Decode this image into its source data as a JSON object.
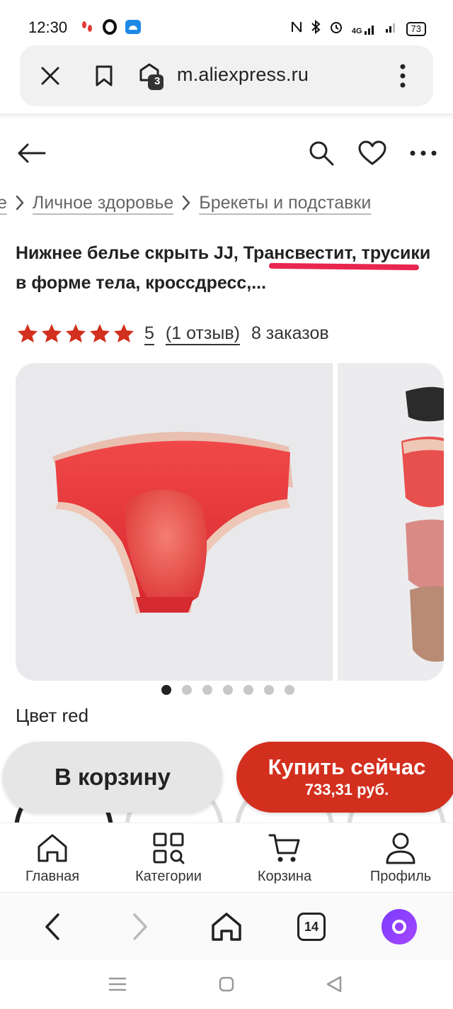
{
  "status": {
    "time": "12:30",
    "network": "4G",
    "battery": "73"
  },
  "browser": {
    "url": "m.aliexpress.ru",
    "tabs_badge": "3"
  },
  "breadcrumb": {
    "partial": "е",
    "items": [
      "Личное здоровье",
      "Брекеты и подставки"
    ]
  },
  "product": {
    "title": "Нижнее белье скрыть JJ, Трансвестит, трусики в форме тела, кроссдресс,...",
    "rating": "5",
    "reviews": "(1 отзыв)",
    "orders": "8 заказов",
    "color_label": "Цвет red",
    "accent_color": "#d32f1e",
    "highlight_color": "#e8264f",
    "gallery_slides": 7,
    "active_slide": 1
  },
  "actions": {
    "cart_label": "В корзину",
    "buy_label": "Купить сейчас",
    "buy_price": "733,31 руб."
  },
  "bottom_nav": {
    "items": [
      {
        "label": "Главная",
        "icon": "home-icon"
      },
      {
        "label": "Категории",
        "icon": "categories-icon"
      },
      {
        "label": "Корзина",
        "icon": "cart-icon"
      },
      {
        "label": "Профиль",
        "icon": "profile-icon"
      }
    ]
  },
  "browser_toolbar": {
    "tabs_count": "14"
  }
}
